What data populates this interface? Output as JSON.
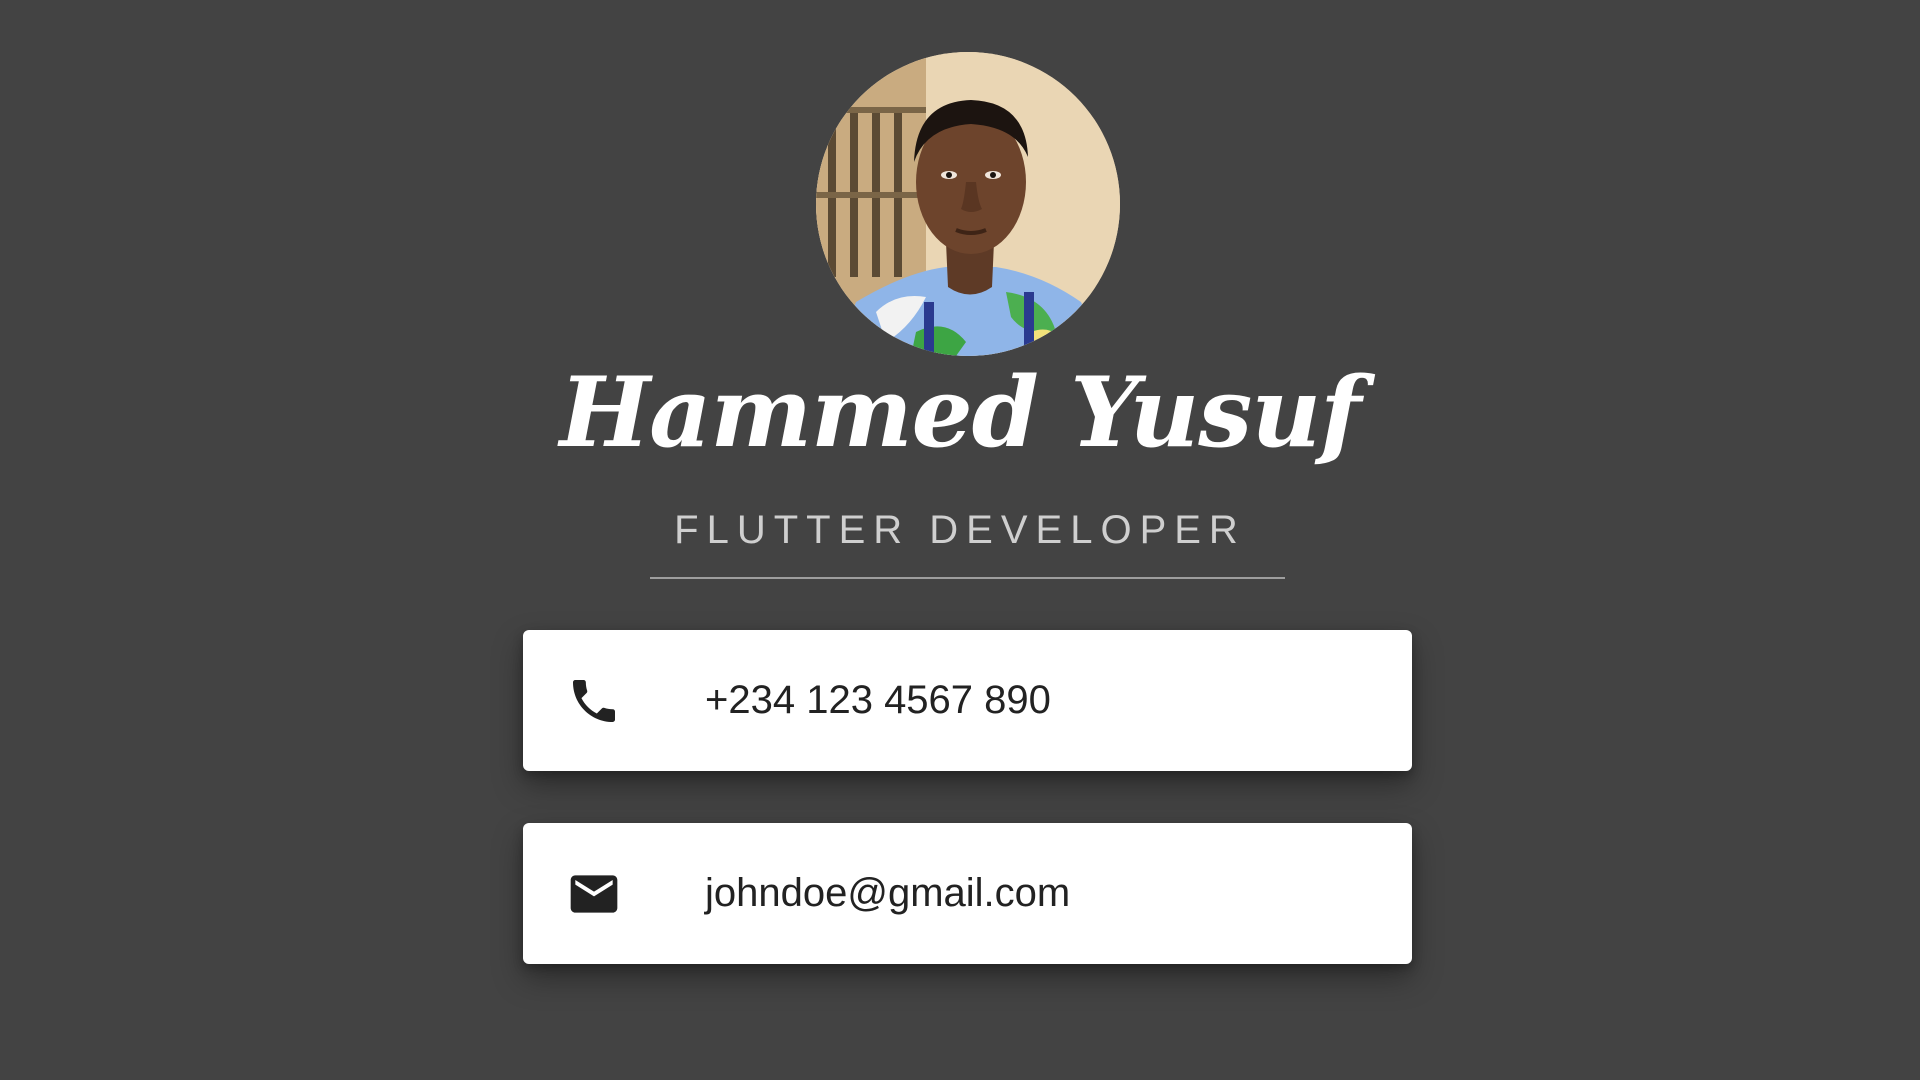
{
  "profile": {
    "name": "Hammed Yusuf",
    "title": "FLUTTER DEVELOPER",
    "avatar_icon": "profile-photo"
  },
  "contacts": {
    "phone": {
      "icon": "phone-icon",
      "value": "+234 123 4567 890"
    },
    "email": {
      "icon": "mail-icon",
      "value": "johndoe@gmail.com"
    }
  },
  "colors": {
    "background": "#434343",
    "card": "#ffffff",
    "name_text": "#ffffff",
    "title_text": "#cfcfcf",
    "divider": "#9e9e9e",
    "icon": "#222222"
  }
}
